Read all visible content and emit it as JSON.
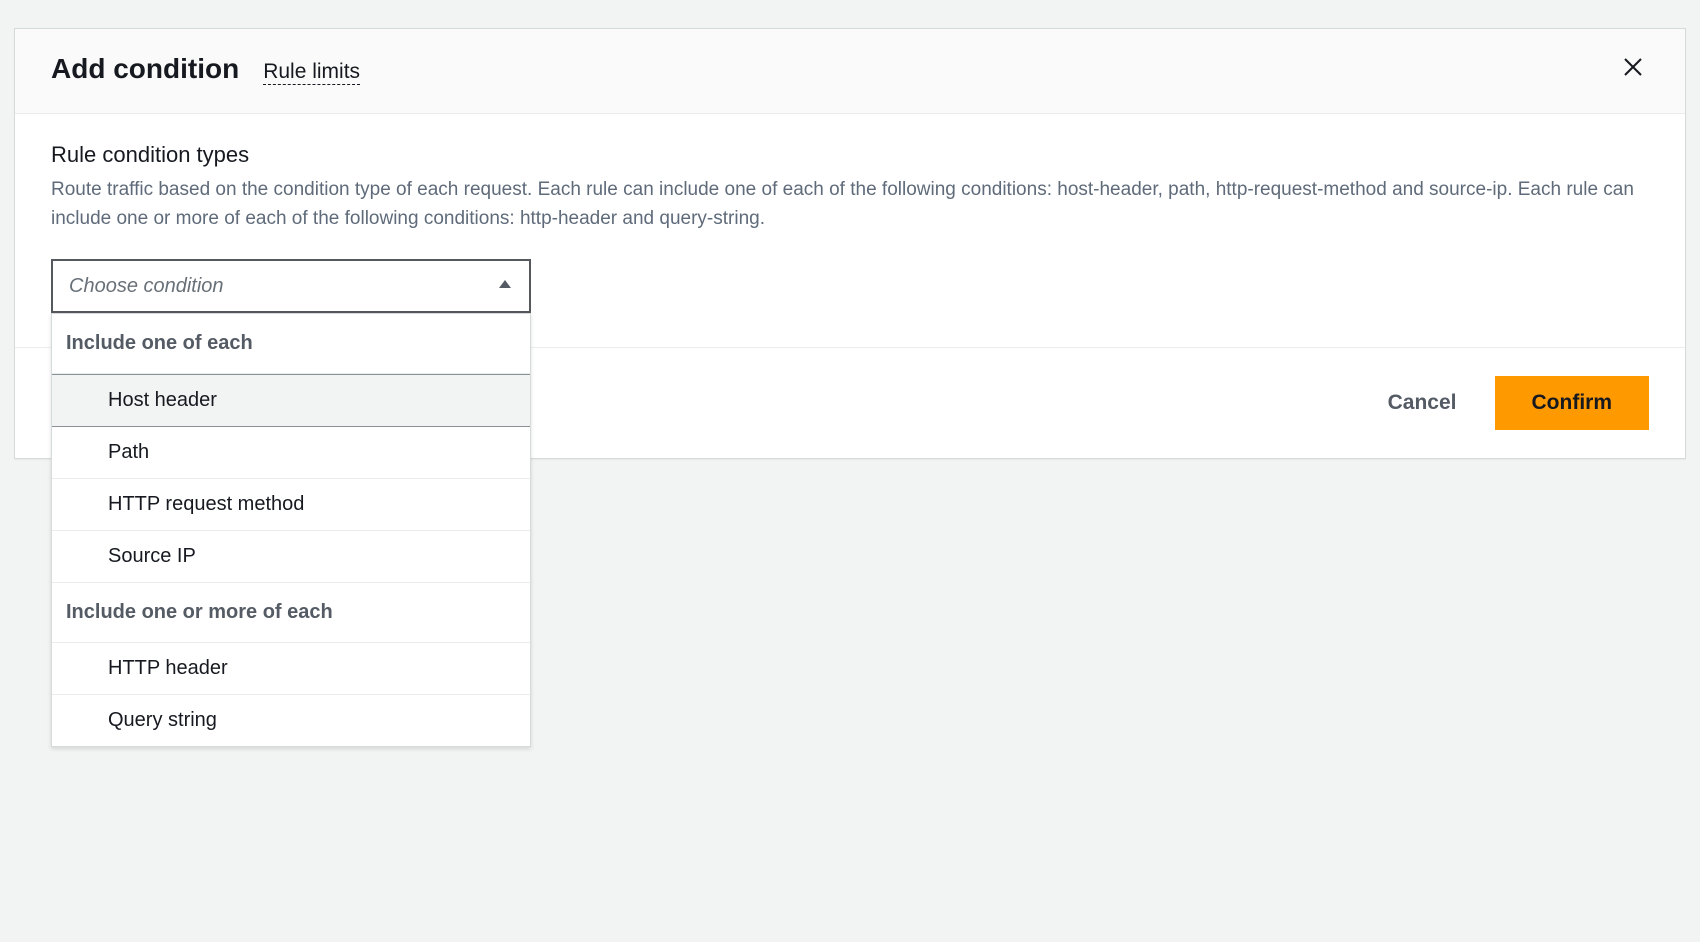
{
  "modal": {
    "title": "Add condition",
    "rule_limits_label": "Rule limits",
    "section_title": "Rule condition types",
    "section_desc": "Route traffic based on the condition type of each request. Each rule can include one of each of the following conditions: host-header, path, http-request-method and source-ip. Each rule can include one or more of each of the following conditions: http-header and query-string.",
    "select_placeholder": "Choose condition"
  },
  "dropdown": {
    "group1_label": "Include one of each",
    "group1_options": [
      {
        "label": "Host header",
        "highlighted": true
      },
      {
        "label": "Path",
        "highlighted": false
      },
      {
        "label": "HTTP request method",
        "highlighted": false
      },
      {
        "label": "Source IP",
        "highlighted": false
      }
    ],
    "group2_label": "Include one or more of each",
    "group2_options": [
      {
        "label": "HTTP header",
        "highlighted": false
      },
      {
        "label": "Query string",
        "highlighted": false
      }
    ]
  },
  "footer": {
    "cancel_label": "Cancel",
    "confirm_label": "Confirm"
  }
}
